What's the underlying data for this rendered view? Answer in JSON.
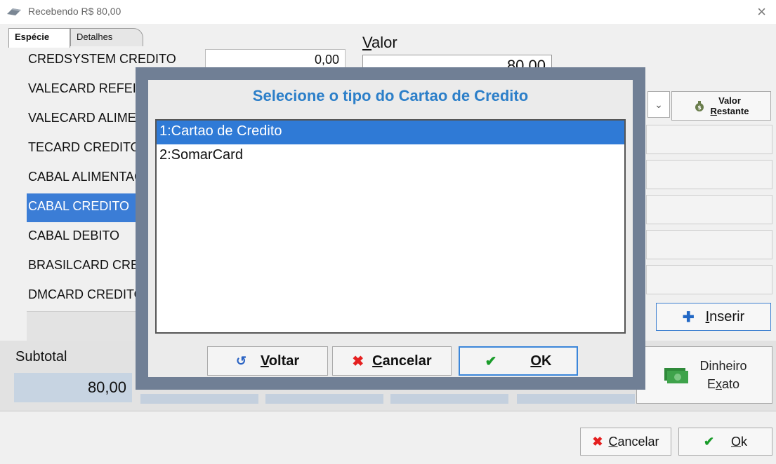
{
  "window": {
    "title": "Recebendo R$ 80,00",
    "close_glyph": "×"
  },
  "tabs": [
    {
      "label": "Espécie",
      "active": true
    },
    {
      "label": "Detalhes",
      "active": false
    }
  ],
  "species": [
    {
      "name": "CREDSYSTEM CREDITO",
      "value": "0,00"
    },
    {
      "name": "VALECARD REFEICAO DEBITO"
    },
    {
      "name": "VALECARD ALIMENTACAO"
    },
    {
      "name": "TECARD CREDITO"
    },
    {
      "name": "CABAL ALIMENTACAO DEBITO"
    },
    {
      "name": "CABAL CREDITO",
      "selected": true
    },
    {
      "name": "CABAL DEBITO"
    },
    {
      "name": "BRASILCARD CREDITO"
    },
    {
      "name": "DMCARD CREDITO"
    }
  ],
  "valor": {
    "label_u": "V",
    "label_rest": "alor",
    "value": "80,00"
  },
  "controls": {
    "valor_restante_line1": "Valor",
    "valor_restante_u": "R",
    "valor_restante_rest": "estante",
    "inserir_u": "I",
    "inserir_rest": "nserir",
    "dinheiro_line1": "Dinheiro",
    "dinheiro_pre": "E",
    "dinheiro_u": "x",
    "dinheiro_rest": "ato"
  },
  "subtotal": {
    "label": "Subtotal",
    "value": "80,00"
  },
  "bottom": {
    "cancelar_u": "C",
    "cancelar_rest": "ancelar",
    "ok_u": "O",
    "ok_rest": "k"
  },
  "modal": {
    "title": "Selecione o tipo do Cartao de Credito",
    "items": [
      {
        "label": "1:Cartao de Credito",
        "selected": true
      },
      {
        "label": "2:SomarCard",
        "selected": false
      }
    ],
    "voltar_u": "V",
    "voltar_rest": "oltar",
    "cancelar_u": "C",
    "cancelar_rest": "ancelar",
    "ok_u": "O",
    "ok_rest": "K"
  },
  "colors": {
    "accent": "#2c7fc9",
    "selection": "#3b7dd6",
    "modal_frame": "#707f95",
    "cancel_red": "#e52020",
    "ok_green": "#1a9c2a"
  },
  "icons": [
    "app-icon",
    "close-icon",
    "combo-chevron-down-icon",
    "money-bag-icon",
    "plus-icon",
    "cash-icon",
    "x-icon",
    "check-icon",
    "back-arrow-icon"
  ]
}
